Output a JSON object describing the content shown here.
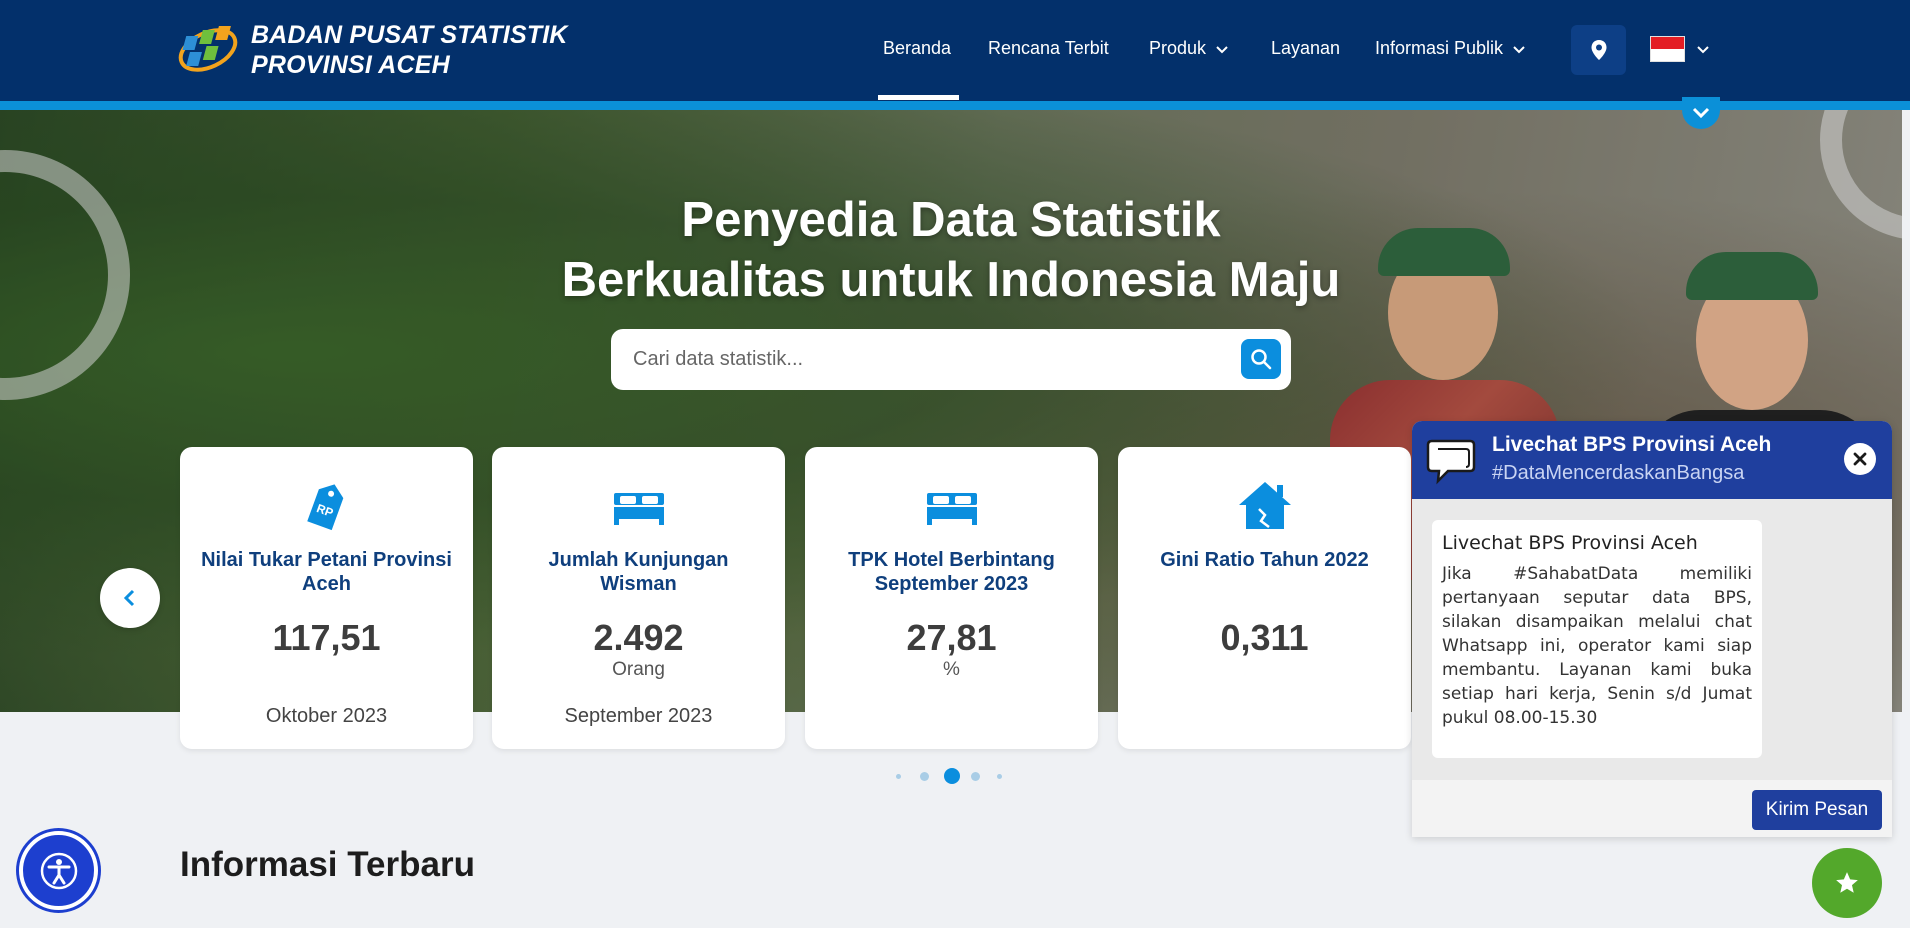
{
  "header": {
    "brand_line1": "BADAN PUSAT STATISTIK",
    "brand_line2": "PROVINSI ACEH",
    "nav": [
      {
        "label": "Beranda"
      },
      {
        "label": "Rencana Terbit"
      },
      {
        "label": "Produk"
      },
      {
        "label": "Layanan"
      },
      {
        "label": "Informasi Publik"
      }
    ],
    "icons": {
      "location": "map-pin-icon",
      "language": "indonesia-flag-icon"
    }
  },
  "hero": {
    "title_line1": "Penyedia Data Statistik",
    "title_line2": "Berkualitas untuk Indonesia Maju"
  },
  "search": {
    "placeholder": "Cari data statistik...",
    "value": ""
  },
  "cards": [
    {
      "icon": "price-tag-icon",
      "tag_text": "RP",
      "title": "Nilai Tukar Petani Provinsi Aceh",
      "value": "117,51",
      "unit": "",
      "period": "Oktober 2023"
    },
    {
      "icon": "bed-icon",
      "title": "Jumlah Kunjungan Wisman",
      "value": "2.492",
      "unit": "Orang",
      "period": "September 2023"
    },
    {
      "icon": "bed-icon",
      "title": "TPK Hotel Berbintang September 2023",
      "value": "27,81",
      "unit": "%",
      "period": ""
    },
    {
      "icon": "house-icon",
      "title": "Gini Ratio Tahun 2022",
      "value": "0,311",
      "unit": "",
      "period": ""
    }
  ],
  "carousel": {
    "active_dot": 3,
    "dot_count": 5
  },
  "section": {
    "title": "Informasi Terbaru"
  },
  "livechat": {
    "title": "Livechat BPS Provinsi Aceh",
    "subtitle": "#DataMencerdaskanBangsa",
    "message_title": "Livechat BPS Provinsi Aceh",
    "message_body": "Jika #SahabatData memiliki pertanyaan seputar data BPS, silakan disampaikan melalui chat Whatsapp ini, operator kami siap membantu. Layanan kami buka setiap hari kerja, Senin s/d Jumat pukul 08.00-15.30",
    "send_label": "Kirim Pesan"
  },
  "colors": {
    "header": "#03306b",
    "accent": "#0b90d8",
    "card_title": "#0f3f7d",
    "chat_header": "#1f3f9e",
    "fab": "#53a82b"
  }
}
